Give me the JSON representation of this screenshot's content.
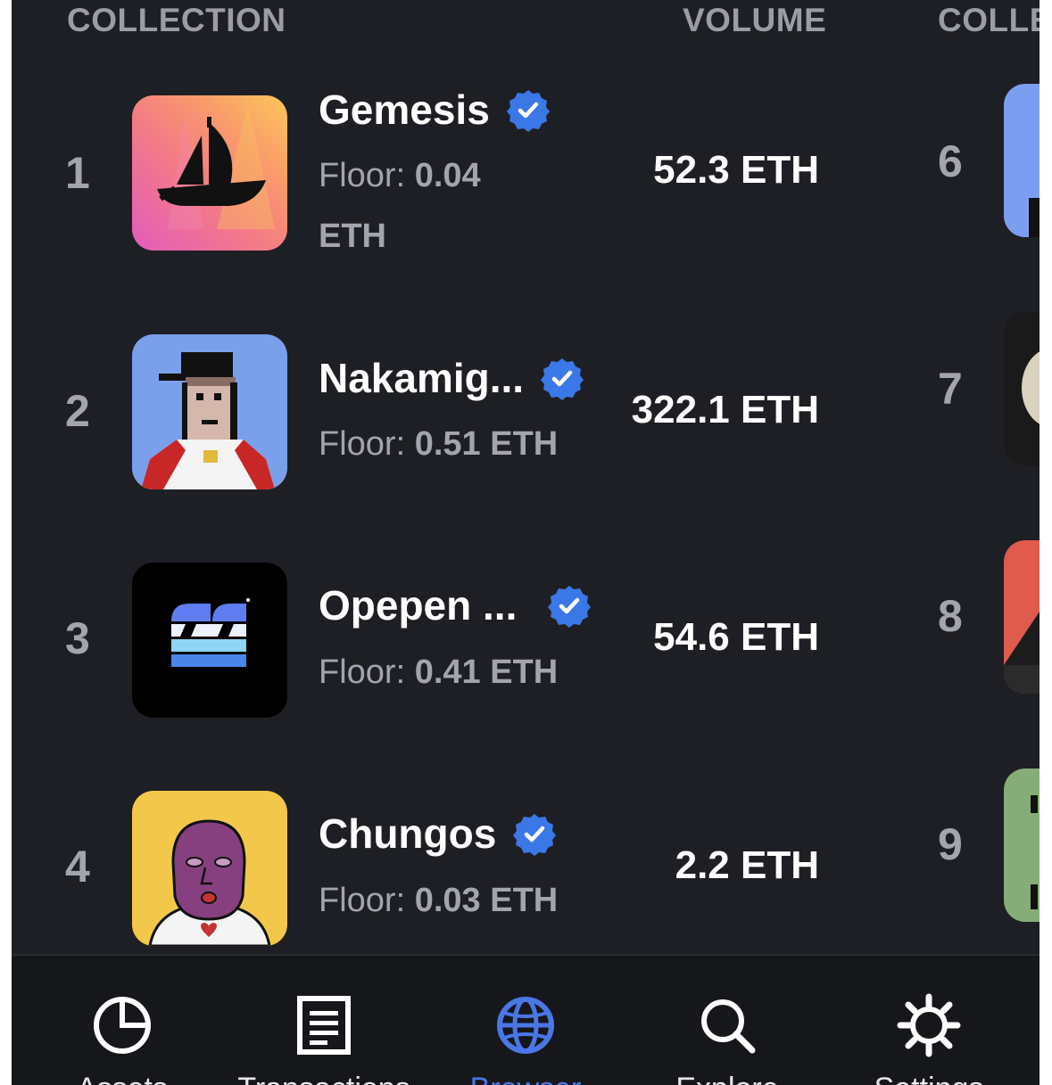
{
  "header": {
    "collection_label": "COLLECTION",
    "volume_label": "VOLUME",
    "collection_label_2": "COLLE"
  },
  "rows": [
    {
      "rank": "1",
      "name": "Gemesis",
      "floor_label": "Floor:",
      "floor_value": "0.04",
      "floor_unit": "ETH",
      "volume": "52.3 ETH",
      "verified": true
    },
    {
      "rank": "2",
      "name": "Nakamig...",
      "floor_label": "Floor:",
      "floor_value": "0.51 ETH",
      "volume": "322.1 ETH",
      "verified": true
    },
    {
      "rank": "3",
      "name": "Opepen ...",
      "floor_label": "Floor:",
      "floor_value": "0.41 ETH",
      "volume": "54.6 ETH",
      "verified": true
    },
    {
      "rank": "4",
      "name": "Chungos",
      "floor_label": "Floor:",
      "floor_value": "0.03 ETH",
      "volume": "2.2 ETH",
      "verified": true
    }
  ],
  "second_column_ranks": [
    "6",
    "7",
    "8",
    "9"
  ],
  "bottom_nav": [
    {
      "label": "Assets",
      "icon": "pie-chart-icon",
      "active": false
    },
    {
      "label": "Transactions",
      "icon": "document-icon",
      "active": false
    },
    {
      "label": "Browser",
      "icon": "globe-icon",
      "active": true
    },
    {
      "label": "Explore",
      "icon": "search-icon",
      "active": false
    },
    {
      "label": "Settings",
      "icon": "gear-icon",
      "active": false
    }
  ],
  "colors": {
    "background": "#1e1f24",
    "nav_background": "#16171b",
    "accent": "#4a77e5",
    "verified_badge": "#3b78e7",
    "muted_text": "#a3a4ad"
  }
}
